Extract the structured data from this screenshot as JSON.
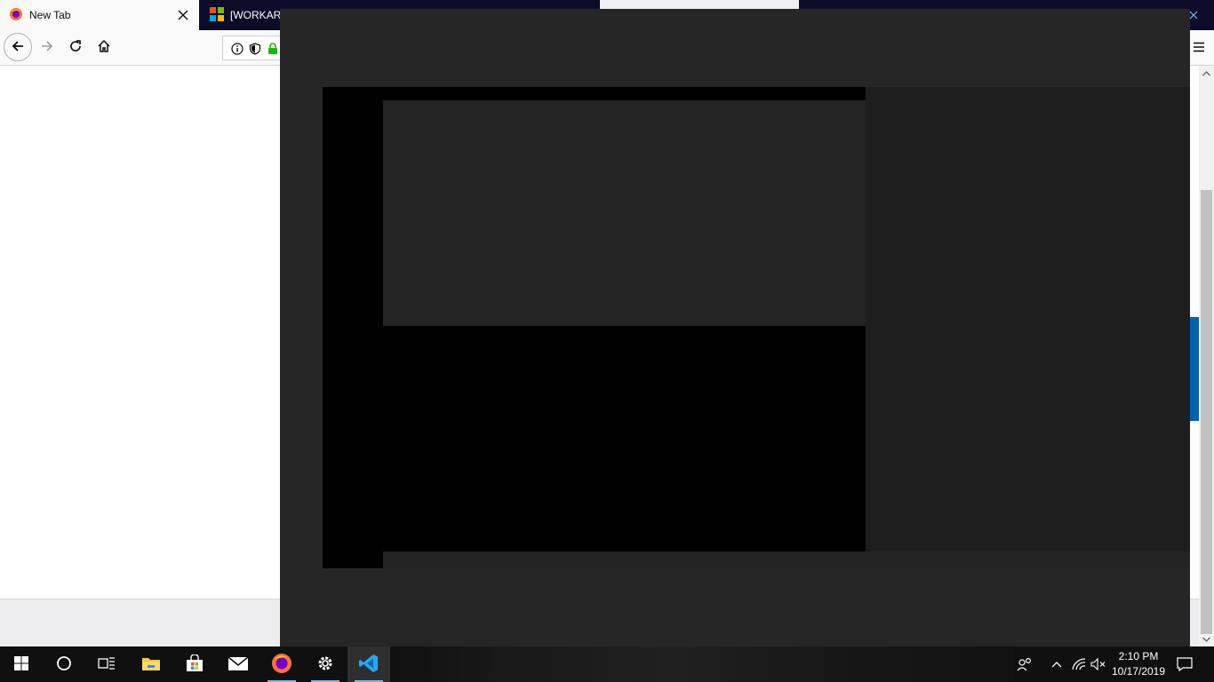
{
  "browser": {
    "tabs": [
      {
        "label": "New Tab",
        "icon": "firefox-icon",
        "active": true
      },
      {
        "label": "[WORKARO",
        "icon": "microsoft-logo-icon",
        "active": false
      }
    ]
  },
  "toolbar": {
    "icons": [
      "back-arrow-icon",
      "forward-arrow-icon",
      "reload-icon",
      "home-icon",
      "info-icon",
      "tracking-shield-icon",
      "lock-icon",
      "hamburger-menu-icon"
    ]
  },
  "taskbar": {
    "apps": [
      "start-icon",
      "cortana-search-icon",
      "task-view-icon",
      "file-explorer-icon",
      "store-icon",
      "mail-icon",
      "firefox-icon",
      "settings-icon",
      "vscode-icon"
    ],
    "clock": {
      "time": "2:10 PM",
      "date": "10/17/2019"
    }
  },
  "colors": {
    "tab_strip": "#0c0c2a",
    "overlay": "#262626",
    "taskbar": "#101010",
    "accent": "#0063b1"
  }
}
